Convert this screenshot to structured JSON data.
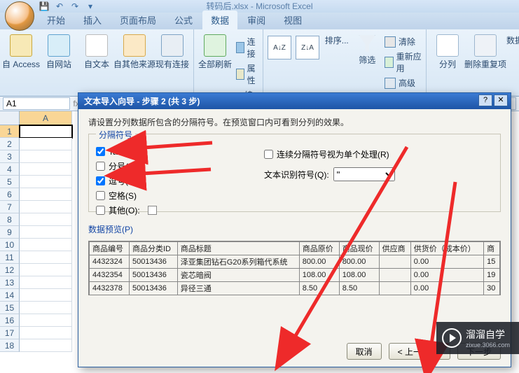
{
  "app": {
    "title": "转码后.xlsx - Microsoft Excel"
  },
  "qat": {
    "save": "💾",
    "undo": "↶",
    "redo": "↷"
  },
  "tabs": {
    "home": "开始",
    "insert": "插入",
    "layout": "页面布局",
    "formula": "公式",
    "data": "数据",
    "review": "审阅",
    "view": "视图"
  },
  "ribbon": {
    "from_access": "自 Access",
    "from_web": "自网站",
    "from_text": "自文本",
    "from_other": "自其他来源",
    "existing": "现有连接",
    "refresh": "全部刷新",
    "connections": "连接",
    "properties": "属性",
    "editlinks": "编辑链接",
    "sort": "排序...",
    "filter": "筛选",
    "clear": "清除",
    "reapply": "重新应用",
    "advanced": "高级",
    "ttc": "分列",
    "dup": "删除重复项",
    "data_opts": "数据有效"
  },
  "namebox": "A1",
  "columns": [
    "A"
  ],
  "rows": [
    "1",
    "2",
    "3",
    "4",
    "5",
    "6",
    "7",
    "8",
    "9",
    "10",
    "11",
    "12",
    "13",
    "14",
    "15",
    "16",
    "17",
    "18"
  ],
  "dialog": {
    "title": "文本导入向导 - 步骤 2 (共 3 步)",
    "instruction": "请设置分列数据所包含的分隔符号。在预览窗口内可看到分列的效果。",
    "legend": "分隔符号",
    "tab": "Tab 键(T)",
    "semicolon": "分号(M)",
    "comma": "逗号(C)",
    "space": "空格(S)",
    "other": "其他(O):",
    "treat": "连续分隔符号视为单个处理(R)",
    "textq": "文本识别符号(Q):",
    "textq_val": "\"",
    "preview_legend": "数据预览(P)",
    "headers": [
      "商品编号",
      "商品分类ID",
      "商品标题",
      "商品原价",
      "商品现价",
      "供应商",
      "供货价（成本价）",
      "商"
    ],
    "rowsdata": [
      [
        "4432324",
        "50013436",
        "泽亚集团钻石G20系列箱代系统",
        "800.00",
        "800.00",
        "",
        "0.00",
        "15"
      ],
      [
        "4432354",
        "50013436",
        "瓷芯暗阀",
        "108.00",
        "108.00",
        "",
        "0.00",
        "19"
      ],
      [
        "4432378",
        "50013436",
        "异径三通",
        "8.50",
        "8.50",
        "",
        "0.00",
        "30"
      ]
    ],
    "cancel": "取消",
    "back": "< 上一步(B)",
    "next": "下一步"
  },
  "watermark": {
    "brand": "溜溜自学",
    "url": "zixue.3066.com"
  },
  "chart_data": {
    "type": "table",
    "title": "数据预览",
    "columns": [
      "商品编号",
      "商品分类ID",
      "商品标题",
      "商品原价",
      "商品现价",
      "供应商",
      "供货价（成本价）"
    ],
    "rows": [
      {
        "商品编号": "4432324",
        "商品分类ID": "50013436",
        "商品标题": "泽亚集团钻石G20系列箱代系统",
        "商品原价": 800.0,
        "商品现价": 800.0,
        "供应商": "",
        "供货价（成本价）": 0.0
      },
      {
        "商品编号": "4432354",
        "商品分类ID": "50013436",
        "商品标题": "瓷芯暗阀",
        "商品原价": 108.0,
        "商品现价": 108.0,
        "供应商": "",
        "供货价（成本价）": 0.0
      },
      {
        "商品编号": "4432378",
        "商品分类ID": "50013436",
        "商品标题": "异径三通",
        "商品原价": 8.5,
        "商品现价": 8.5,
        "供应商": "",
        "供货价（成本价）": 0.0
      }
    ]
  }
}
